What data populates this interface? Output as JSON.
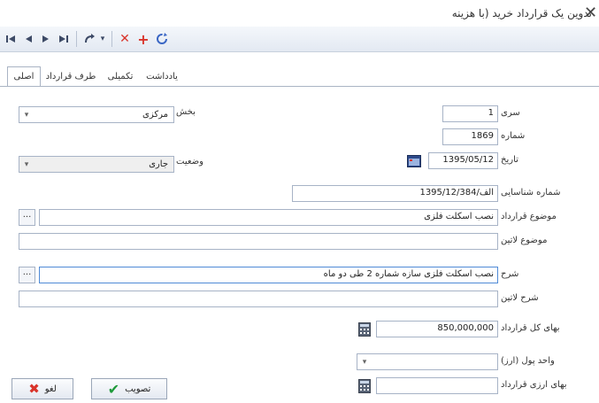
{
  "window": {
    "title": "تدوين يک قرارداد خريد (با هزينه"
  },
  "toolbar": {
    "icons": [
      "first-icon",
      "prev-icon",
      "next-icon",
      "last-icon",
      "action-icon",
      "dropdown-icon",
      "delete-icon",
      "add-icon",
      "refresh-icon"
    ]
  },
  "tabs": [
    {
      "label": "اصلی",
      "active": true
    },
    {
      "label": "طرف قرارداد"
    },
    {
      "label": "تکميلی"
    },
    {
      "label": "يادداشت"
    }
  ],
  "form": {
    "series": {
      "label": "سری",
      "value": "1"
    },
    "number": {
      "label": "شماره",
      "value": "1869"
    },
    "date": {
      "label": "تاريخ",
      "value": "1395/05/12"
    },
    "section": {
      "label": "بخش",
      "value": "مرکزی"
    },
    "status": {
      "label": "وضعيت",
      "value": "جاری"
    },
    "id_number": {
      "label": "شماره شناسايی",
      "value": "الف/1395/12/384"
    },
    "subject": {
      "label": "موضوع قرارداد",
      "value": "نصب اسکلت فلزی"
    },
    "latin_subject": {
      "label": "موضوع لاتين",
      "value": ""
    },
    "description": {
      "label": "شرح",
      "value": "نصب اسکلت فلزی سازه شماره 2 طی دو ماه"
    },
    "latin_description": {
      "label": "شرح لاتين",
      "value": ""
    },
    "total_price": {
      "label": "بهای کل قرارداد",
      "value": "850,000,000"
    },
    "currency_unit": {
      "label": "واحد پول (ارز)",
      "value": ""
    },
    "currency_price": {
      "label": "بهای ارزی قرارداد",
      "value": ""
    }
  },
  "buttons": {
    "ok": "تصويب",
    "cancel": "لغو"
  },
  "colors": {
    "accent_red": "#d9342b",
    "ok_green": "#1e9a3a",
    "focus_border": "#4f8ad6"
  }
}
